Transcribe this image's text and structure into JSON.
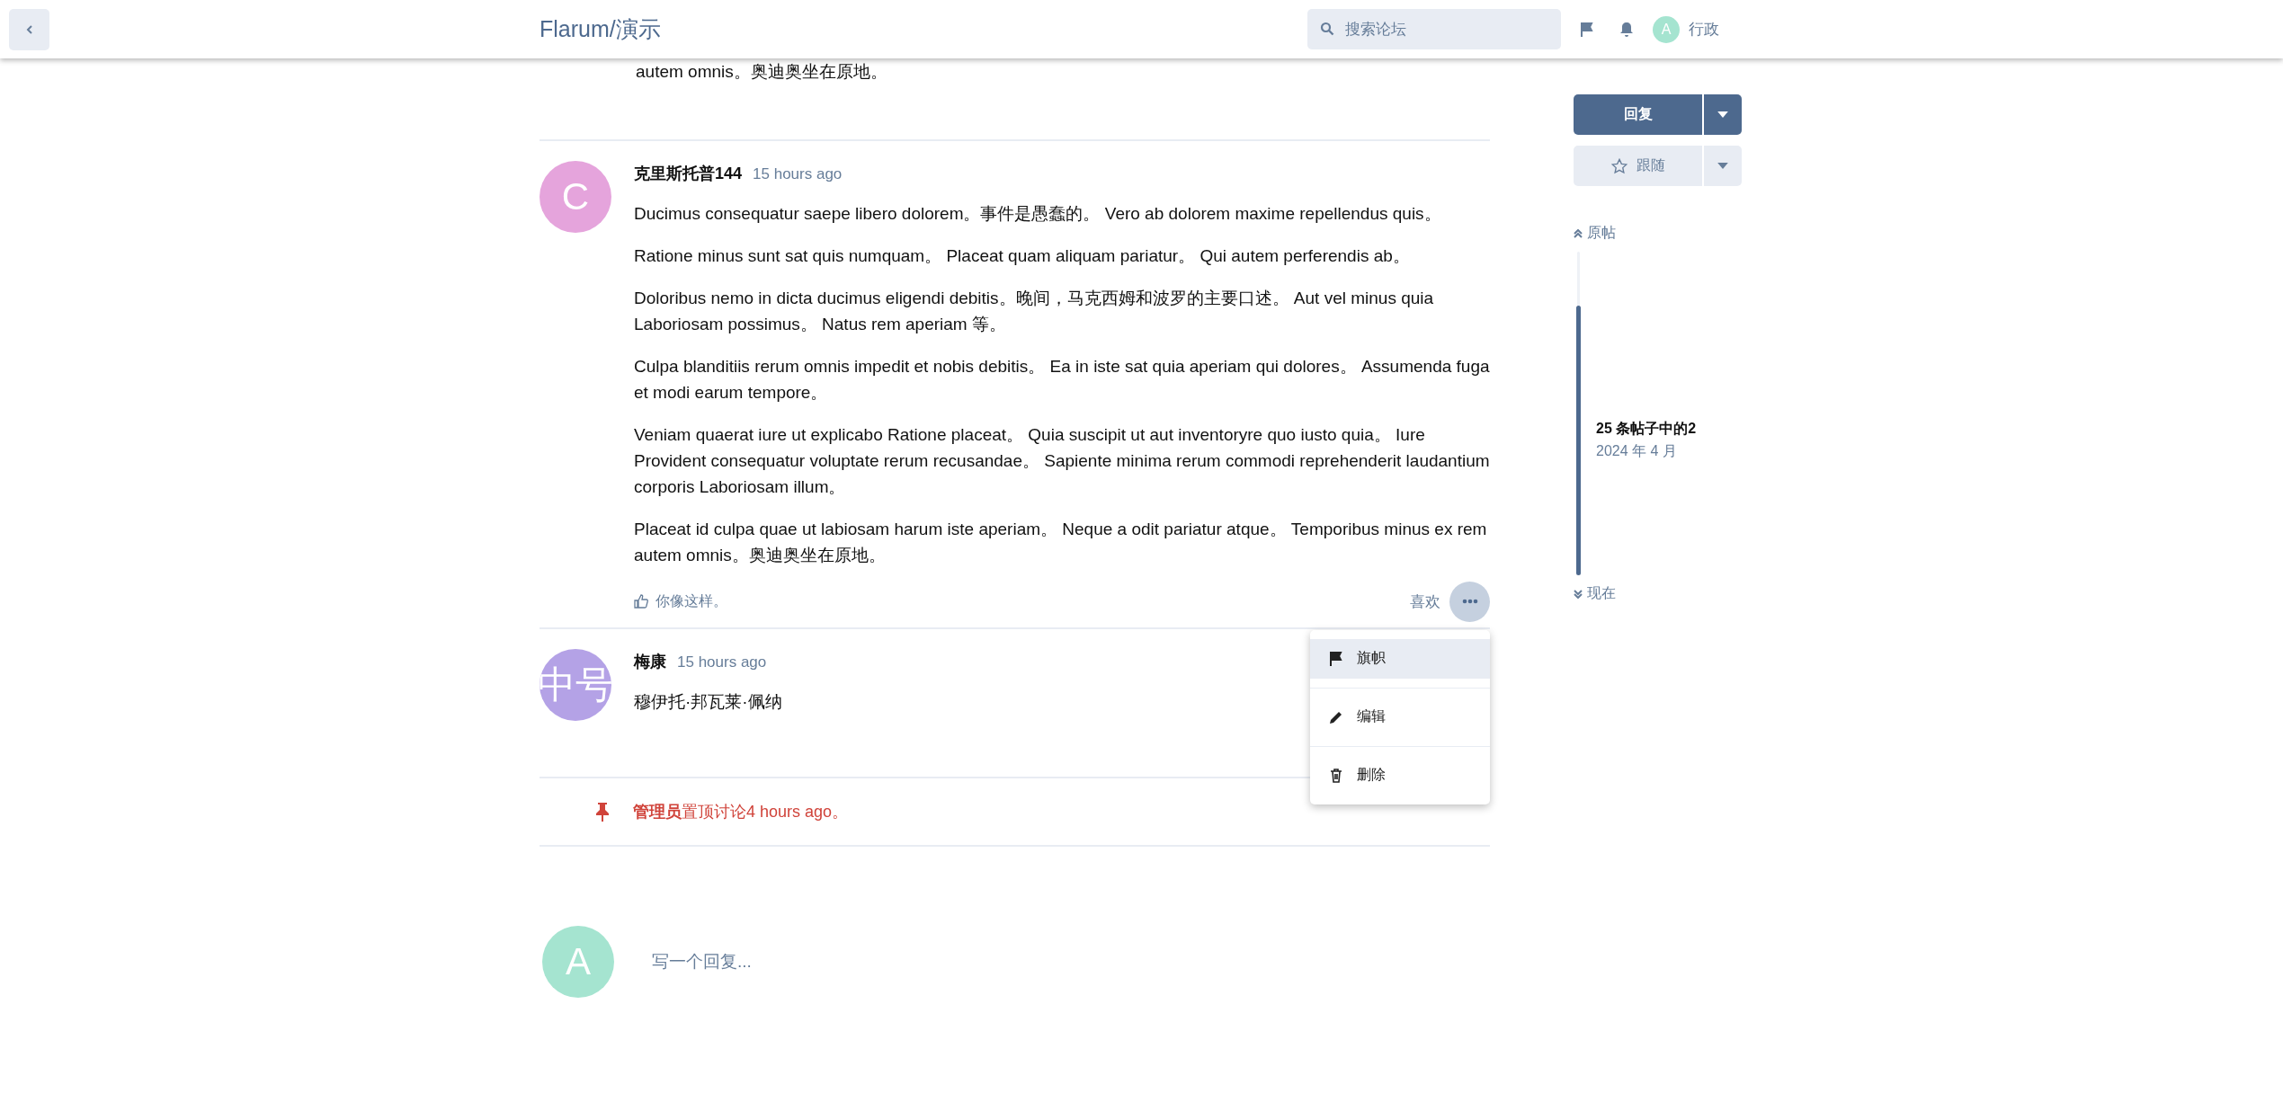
{
  "header": {
    "title": "Flarum/演示",
    "search": {
      "placeholder": "搜索论坛"
    },
    "user": {
      "avatar_letter": "A",
      "color": "#a5e4d0",
      "name": "行政"
    }
  },
  "previous_post_tail": "autem omnis。奥迪奥坐在原地。",
  "posts": [
    {
      "kind": "comment",
      "author": "克里斯托普144",
      "time": "15 hours ago",
      "avatar_letter": "C",
      "color": "#e5a4dc",
      "paragraphs": [
        "Ducimus consequatur saepe libero dolorem。事件是愚蠢的。 Vero ab dolorem maxime repellendus quis。",
        "Ratione minus sunt sat quis numquam。 Placeat quam aliquam pariatur。 Qui autem perferendis ab。",
        "Doloribus nemo in dicta ducimus eligendi debitis。晚间，马克西姆和波罗的主要口述。 Aut vel minus quia Laboriosam possimus。 Natus rem aperiam 等。",
        "Culpa blanditiis rerum omnis impedit et nobis debitis。 Ea in iste sat quia aperiam qui dolores。 Assumenda fuga et modi earum tempore。",
        "Veniam quaerat iure ut explicabo Ratione placeat。 Quia suscipit ut aut inventoryre quo iusto quia。 Iure Provident consequatur voluptate rerum recusandae。 Sapiente minima rerum commodi reprehenderit laudantium corporis Laboriosam illum。",
        "Placeat id culpa quae ut labiosam harum iste aperiam。 Neque a odit pariatur atque。 Temporibus minus ex rem autem omnis。奥迪奥坐在原地。"
      ],
      "footer": {
        "liked_by": "你像这样。",
        "like_label": "喜欢"
      },
      "menu": [
        {
          "kind": "flag",
          "label": "旗帜",
          "selected": true
        },
        {
          "kind": "edit",
          "label": "编辑",
          "selected": false
        },
        {
          "kind": "delete",
          "label": "删除",
          "selected": false
        }
      ]
    },
    {
      "kind": "comment",
      "author": "梅康",
      "time": "15 hours ago",
      "avatar_letter": "中号",
      "color": "#b4a2e6",
      "paragraphs": [
        "穆伊托·邦瓦莱·佩纳"
      ]
    },
    {
      "kind": "event",
      "text": "**管理员**置顶讨论4 hours ago。"
    }
  ],
  "composer": {
    "avatar_letter": "A",
    "color": "#a5e4d0",
    "placeholder": "写一个回复..."
  },
  "sidebar": {
    "reply_button": "回复",
    "follow_button": "跟随",
    "scrubber": {
      "top_label": "原帖",
      "position": "25 条帖子中的2",
      "date": "2024 年 4 月",
      "bottom_label": "现在"
    }
  }
}
